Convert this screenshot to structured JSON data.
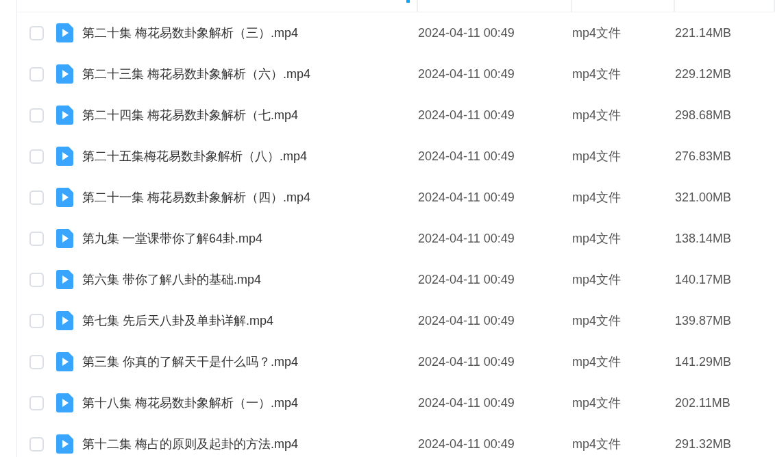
{
  "files": [
    {
      "name": "第二十集 梅花易数卦象解析（三）.mp4",
      "modified": "2024-04-11 00:49",
      "type": "mp4文件",
      "size": "221.14MB",
      "checked": false
    },
    {
      "name": "第二十三集 梅花易数卦象解析（六）.mp4",
      "modified": "2024-04-11 00:49",
      "type": "mp4文件",
      "size": "229.12MB",
      "checked": false
    },
    {
      "name": "第二十四集 梅花易数卦象解析（七.mp4",
      "modified": "2024-04-11 00:49",
      "type": "mp4文件",
      "size": "298.68MB",
      "checked": false
    },
    {
      "name": "第二十五集梅花易数卦象解析（八）.mp4",
      "modified": "2024-04-11 00:49",
      "type": "mp4文件",
      "size": "276.83MB",
      "checked": false
    },
    {
      "name": "第二十一集 梅花易数卦象解析（四）.mp4",
      "modified": "2024-04-11 00:49",
      "type": "mp4文件",
      "size": "321.00MB",
      "checked": false
    },
    {
      "name": "第九集 一堂课带你了解64卦.mp4",
      "modified": "2024-04-11 00:49",
      "type": "mp4文件",
      "size": "138.14MB",
      "checked": false
    },
    {
      "name": "第六集 带你了解八卦的基础.mp4",
      "modified": "2024-04-11 00:49",
      "type": "mp4文件",
      "size": "140.17MB",
      "checked": false
    },
    {
      "name": "第七集 先后天八卦及单卦详解.mp4",
      "modified": "2024-04-11 00:49",
      "type": "mp4文件",
      "size": "139.87MB",
      "checked": false
    },
    {
      "name": "第三集 你真的了解天干是什么吗？.mp4",
      "modified": "2024-04-11 00:49",
      "type": "mp4文件",
      "size": "141.29MB",
      "checked": false
    },
    {
      "name": "第十八集 梅花易数卦象解析（一）.mp4",
      "modified": "2024-04-11 00:49",
      "type": "mp4文件",
      "size": "202.11MB",
      "checked": false
    },
    {
      "name": "第十二集 梅占的原则及起卦的方法.mp4",
      "modified": "2024-04-11 00:49",
      "type": "mp4文件",
      "size": "291.32MB",
      "checked": false
    }
  ]
}
